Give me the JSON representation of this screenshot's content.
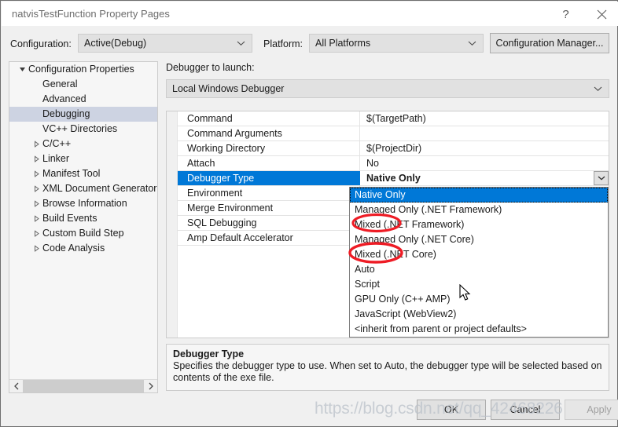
{
  "window": {
    "title": "natvisTestFunction Property Pages",
    "help_icon": "question-mark-icon",
    "close_icon": "close-icon"
  },
  "toolbar": {
    "configuration_label": "Configuration:",
    "configuration_value": "Active(Debug)",
    "platform_label": "Platform:",
    "platform_value": "All Platforms",
    "configuration_manager_label": "Configuration Manager..."
  },
  "sidebar": {
    "items": [
      {
        "label": "Configuration Properties",
        "depth": 0,
        "twisty": "expanded",
        "selected": false
      },
      {
        "label": "General",
        "depth": 1,
        "twisty": "none",
        "selected": false
      },
      {
        "label": "Advanced",
        "depth": 1,
        "twisty": "none",
        "selected": false
      },
      {
        "label": "Debugging",
        "depth": 1,
        "twisty": "none",
        "selected": true
      },
      {
        "label": "VC++ Directories",
        "depth": 1,
        "twisty": "none",
        "selected": false
      },
      {
        "label": "C/C++",
        "depth": 1,
        "twisty": "collapsed",
        "selected": false
      },
      {
        "label": "Linker",
        "depth": 1,
        "twisty": "collapsed",
        "selected": false
      },
      {
        "label": "Manifest Tool",
        "depth": 1,
        "twisty": "collapsed",
        "selected": false
      },
      {
        "label": "XML Document Generator",
        "depth": 1,
        "twisty": "collapsed",
        "selected": false
      },
      {
        "label": "Browse Information",
        "depth": 1,
        "twisty": "collapsed",
        "selected": false
      },
      {
        "label": "Build Events",
        "depth": 1,
        "twisty": "collapsed",
        "selected": false
      },
      {
        "label": "Custom Build Step",
        "depth": 1,
        "twisty": "collapsed",
        "selected": false
      },
      {
        "label": "Code Analysis",
        "depth": 1,
        "twisty": "collapsed",
        "selected": false
      }
    ],
    "scroll_left_icon": "chevron-left-icon",
    "scroll_right_icon": "chevron-right-icon"
  },
  "main": {
    "launch_label": "Debugger to launch:",
    "launch_value": "Local Windows Debugger",
    "grid_rows": [
      {
        "name": "Command",
        "value": "$(TargetPath)",
        "selected": false
      },
      {
        "name": "Command Arguments",
        "value": "",
        "selected": false
      },
      {
        "name": "Working Directory",
        "value": "$(ProjectDir)",
        "selected": false
      },
      {
        "name": "Attach",
        "value": "No",
        "selected": false
      },
      {
        "name": "Debugger Type",
        "value": "Native Only",
        "selected": true
      },
      {
        "name": "Environment",
        "value": "",
        "selected": false
      },
      {
        "name": "Merge Environment",
        "value": "",
        "selected": false
      },
      {
        "name": "SQL Debugging",
        "value": "",
        "selected": false
      },
      {
        "name": "Amp Default Accelerator",
        "value": "",
        "selected": false
      }
    ],
    "dropdown": {
      "open": true,
      "options": [
        {
          "label": "Native Only",
          "selected": true
        },
        {
          "label": "Managed Only (.NET Framework)",
          "selected": false
        },
        {
          "label": "Mixed (.NET Framework)",
          "selected": false
        },
        {
          "label": "Managed Only (.NET Core)",
          "selected": false
        },
        {
          "label": "Mixed (.NET Core)",
          "selected": false
        },
        {
          "label": "Auto",
          "selected": false
        },
        {
          "label": "Script",
          "selected": false
        },
        {
          "label": "GPU Only (C++ AMP)",
          "selected": false
        },
        {
          "label": "JavaScript (WebView2)",
          "selected": false
        },
        {
          "label": "<inherit from parent or project defaults>",
          "selected": false
        }
      ]
    }
  },
  "description": {
    "title": "Debugger Type",
    "body": "Specifies the debugger type to use. When set to Auto, the debugger type will be selected based on contents of the exe file."
  },
  "footer": {
    "ok_label": "OK",
    "cancel_label": "Cancel",
    "apply_label": "Apply"
  },
  "overlay": {
    "watermark": "https://blog.csdn.net/qq_42468226",
    "annotation_color": "#ee1c25",
    "annotation_count": 2,
    "cursor": "arrow-pointer"
  },
  "colors": {
    "selection_blue": "#0078d7",
    "tree_selection": "#cdd3e2",
    "dialog_background": "#f0f0f0",
    "control_background": "#e1e1e1"
  }
}
